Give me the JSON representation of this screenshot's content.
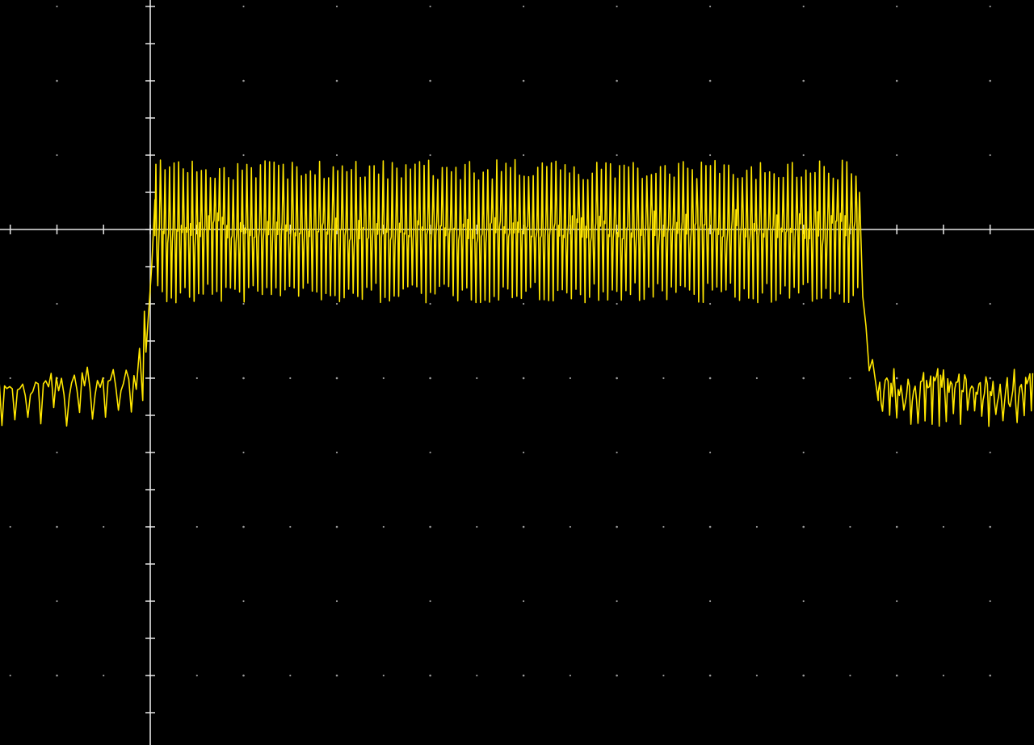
{
  "screen": {
    "background": "#000000",
    "grid_color": "#9a9a9a",
    "axis_color": "#e6e6e6",
    "trace_color": "#ffe600"
  },
  "chart_data": {
    "type": "line",
    "description_kind": "oscilloscope-trace",
    "title": "",
    "xlabel": "",
    "ylabel": "",
    "grid": true,
    "divisions": {
      "x": 11,
      "y": 8,
      "minor_per_division": 4
    },
    "xlim": [
      -3.2,
      7.8
    ],
    "ylim": [
      -4.0,
      4.0
    ],
    "trigger_time_div": 0,
    "series": [
      {
        "segments": [
          {
            "from_div": -3.2,
            "to_div": -0.15,
            "low": -5.3,
            "high": -3.7,
            "mid": -4.25,
            "cycles": 22
          },
          {
            "from_div": -0.15,
            "to_div": 0.05,
            "kind": "rising-edge"
          },
          {
            "from_div": 0.05,
            "to_div": 7.6,
            "low": -1.97,
            "high": 1.88,
            "mid": 0.0,
            "cycles": 155
          },
          {
            "from_div": 7.6,
            "to_div": 7.8,
            "kind": "falling-edge"
          },
          {
            "from_div": 7.8,
            "to_div": 7.8,
            "low": -5.3,
            "high": -3.7,
            "mid": -4.25,
            "cycles": 22
          }
        ]
      }
    ]
  }
}
